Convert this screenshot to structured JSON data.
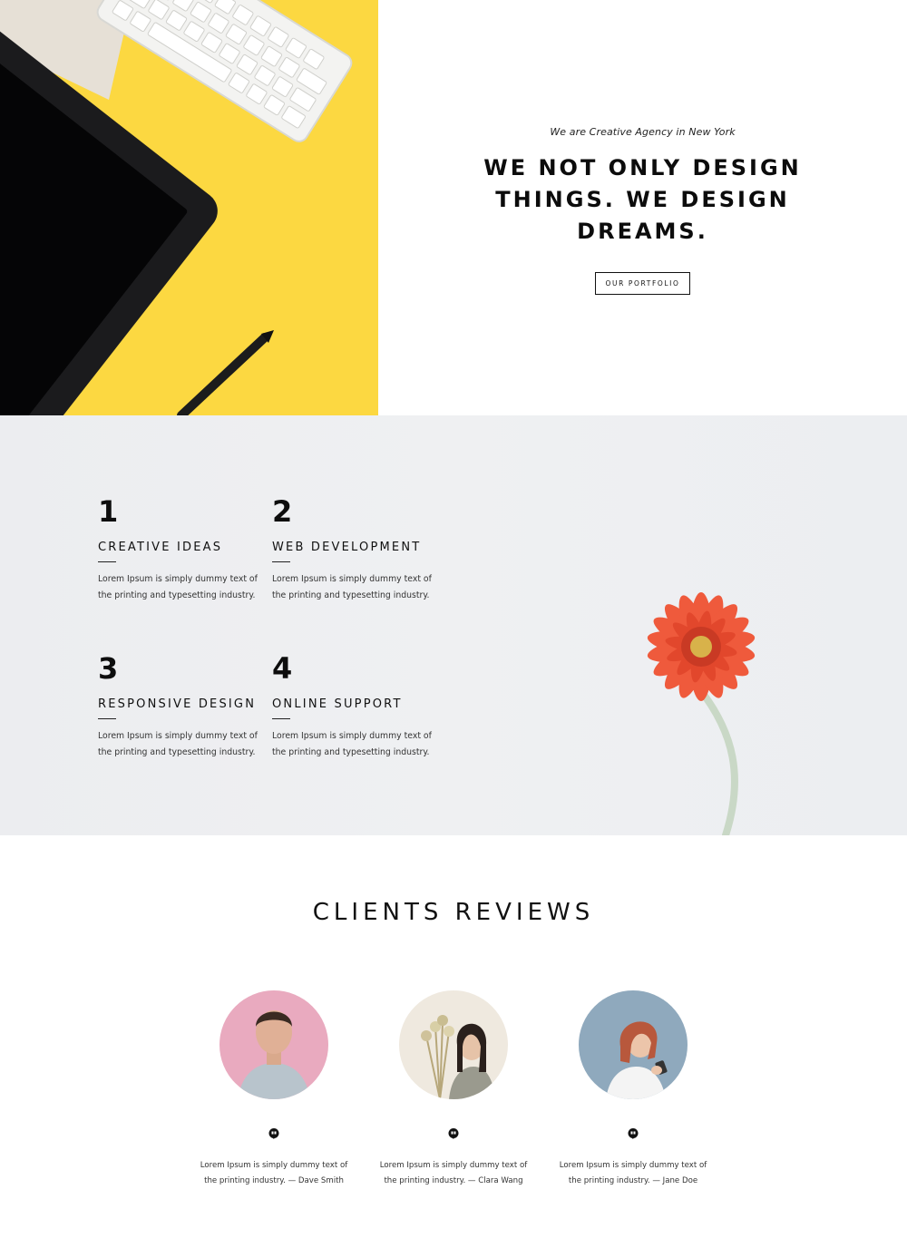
{
  "hero": {
    "tagline": "We are Creative Agency in New York",
    "headline": "WE NOT ONLY DESIGN THINGS. WE DESIGN DREAMS.",
    "button_label": "OUR PORTFOLIO",
    "image_colors": {
      "background": "#fcd841",
      "tablet": "#1b1b1d",
      "keyboard": "#eeeeec",
      "paper": "#e6e0d6"
    }
  },
  "features": {
    "items": [
      {
        "number": "1",
        "title": "CREATIVE IDEAS",
        "description": "Lorem Ipsum is simply dummy text of the printing and typesetting industry."
      },
      {
        "number": "2",
        "title": "WEB DEVELOPMENT",
        "description": "Lorem Ipsum is simply dummy text of the printing and typesetting industry."
      },
      {
        "number": "3",
        "title": "RESPONSIVE DESIGN",
        "description": "Lorem Ipsum is simply dummy text of the printing and typesetting industry."
      },
      {
        "number": "4",
        "title": "ONLINE SUPPORT",
        "description": "Lorem Ipsum is simply dummy text of the printing and typesetting industry."
      }
    ],
    "flower_color": "#ef5a3c"
  },
  "reviews": {
    "title": "CLIENTS REVIEWS",
    "items": [
      {
        "text": "Lorem Ipsum is simply dummy text of the printing industry. — Dave Smith",
        "avatar_bg": "#e9aabf"
      },
      {
        "text": "Lorem Ipsum is simply dummy text of the printing industry. — Clara Wang",
        "avatar_bg": "#efe9df"
      },
      {
        "text": "Lorem Ipsum is simply dummy text of the printing industry. — Jane Doe",
        "avatar_bg": "#8fa9bd"
      }
    ]
  }
}
